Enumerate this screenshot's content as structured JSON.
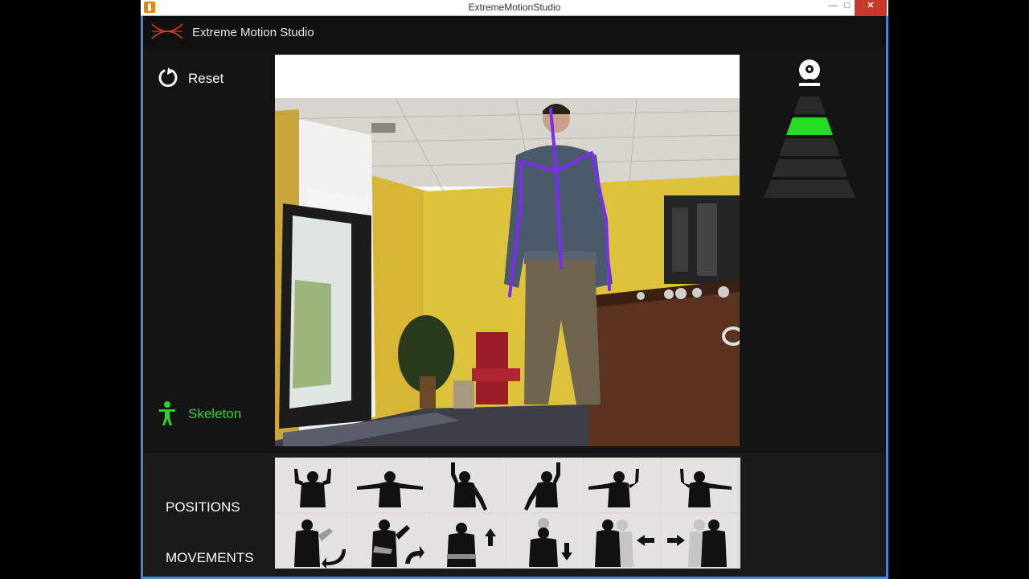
{
  "window": {
    "title": "ExtremeMotionStudio",
    "controls": {
      "minimize": "—",
      "maximize": "□",
      "close": "✕"
    }
  },
  "header": {
    "app_name": "Extreme Motion Studio",
    "logo_icon": "extreme-motion-logo-icon"
  },
  "sidebar": {
    "reset": {
      "label": "Reset",
      "icon": "reset-icon"
    },
    "skeleton": {
      "label": "Skeleton",
      "icon": "person-icon"
    }
  },
  "right_panel": {
    "camera_icon": "webcam-icon",
    "distance_indicator": {
      "levels": 5,
      "active_level": 2,
      "active_color": "#22dd22"
    }
  },
  "gestures": {
    "positions_label": "POSITIONS",
    "movements_label": "MOVEMENTS",
    "positions": [
      "both-arms-up-pose",
      "arms-out-pose",
      "right-arm-up-pose",
      "left-arm-up-pose",
      "left-arm-up-right-out-pose",
      "right-arm-up-left-out-pose"
    ],
    "movements": [
      "circle-left-movement",
      "circle-right-movement",
      "move-up-movement",
      "move-down-movement",
      "move-left-movement",
      "move-right-movement"
    ]
  },
  "colors": {
    "accent_green": "#2fd02f",
    "skeleton_purple": "#7a2cf0",
    "close_red": "#c7392b"
  }
}
